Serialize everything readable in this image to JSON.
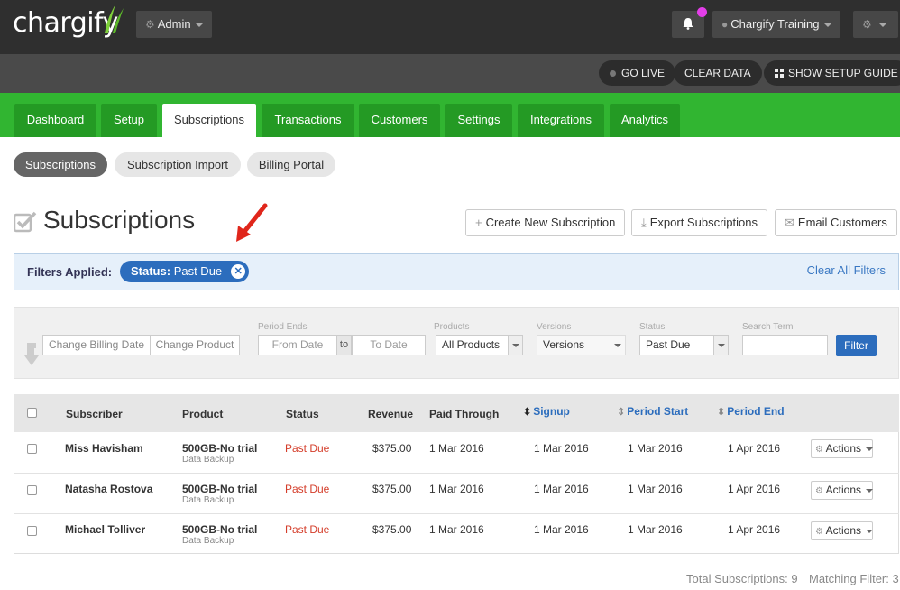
{
  "topbar": {
    "logo": "chargify",
    "admin_label": "Admin",
    "account_label": "Chargify Training"
  },
  "setupbar": {
    "go_live": "GO LIVE",
    "clear_data": "CLEAR DATA",
    "show_setup_guide": "SHOW SETUP GUIDE"
  },
  "nav": {
    "tabs": [
      "Dashboard",
      "Setup",
      "Subscriptions",
      "Transactions",
      "Customers",
      "Settings",
      "Integrations",
      "Analytics"
    ],
    "active": "Subscriptions"
  },
  "subnav": [
    "Subscriptions",
    "Subscription Import",
    "Billing Portal"
  ],
  "page": {
    "title": "Subscriptions",
    "create_btn": "Create New Subscription",
    "export_btn": "Export Subscriptions",
    "email_btn": "Email Customers"
  },
  "filters_applied": {
    "label": "Filters Applied:",
    "chip_key": "Status:",
    "chip_value": "Past Due",
    "clear_all": "Clear All Filters"
  },
  "filter_form": {
    "change_billing_date": "Change Billing Date",
    "change_product": "Change Product",
    "period_ends_label": "Period Ends",
    "from_date": "From Date",
    "to": "to",
    "to_date": "To Date",
    "products_label": "Products",
    "products_value": "All Products",
    "versions_label": "Versions",
    "versions_value": "Versions",
    "status_label": "Status",
    "status_value": "Past Due",
    "search_label": "Search Term",
    "search_value": "",
    "filter_btn": "Filter"
  },
  "table": {
    "headers": {
      "subscriber": "Subscriber",
      "product": "Product",
      "status": "Status",
      "revenue": "Revenue",
      "paid_through": "Paid Through",
      "signup": "Signup",
      "period_start": "Period Start",
      "period_end": "Period End"
    },
    "actions_label": "Actions",
    "rows": [
      {
        "subscriber": "Miss Havisham",
        "product": "500GB-No trial",
        "family": "Data Backup",
        "status": "Past Due",
        "revenue": "$375.00",
        "paid_through": "1 Mar 2016",
        "signup": "1 Mar 2016",
        "period_start": "1 Mar 2016",
        "period_end": "1 Apr 2016"
      },
      {
        "subscriber": "Natasha Rostova",
        "product": "500GB-No trial",
        "family": "Data Backup",
        "status": "Past Due",
        "revenue": "$375.00",
        "paid_through": "1 Mar 2016",
        "signup": "1 Mar 2016",
        "period_start": "1 Mar 2016",
        "period_end": "1 Apr 2016"
      },
      {
        "subscriber": "Michael Tolliver",
        "product": "500GB-No trial",
        "family": "Data Backup",
        "status": "Past Due",
        "revenue": "$375.00",
        "paid_through": "1 Mar 2016",
        "signup": "1 Mar 2016",
        "period_start": "1 Mar 2016",
        "period_end": "1 Apr 2016"
      }
    ]
  },
  "footer": {
    "total": "Total Subscriptions: 9",
    "matching": "Matching Filter: 3"
  },
  "colors": {
    "nav_green": "#31b531",
    "tab_green": "#249a24",
    "primary_blue": "#2c6dbd",
    "status_red": "#d43d2a",
    "notification": "#e33ee8"
  },
  "icons": [
    "gear-icon",
    "bell-icon",
    "globe-icon",
    "settings-menu-icon",
    "grid-icon",
    "checkbox-icon",
    "plus-icon",
    "download-icon",
    "envelope-icon",
    "close-icon",
    "sort-icon"
  ]
}
